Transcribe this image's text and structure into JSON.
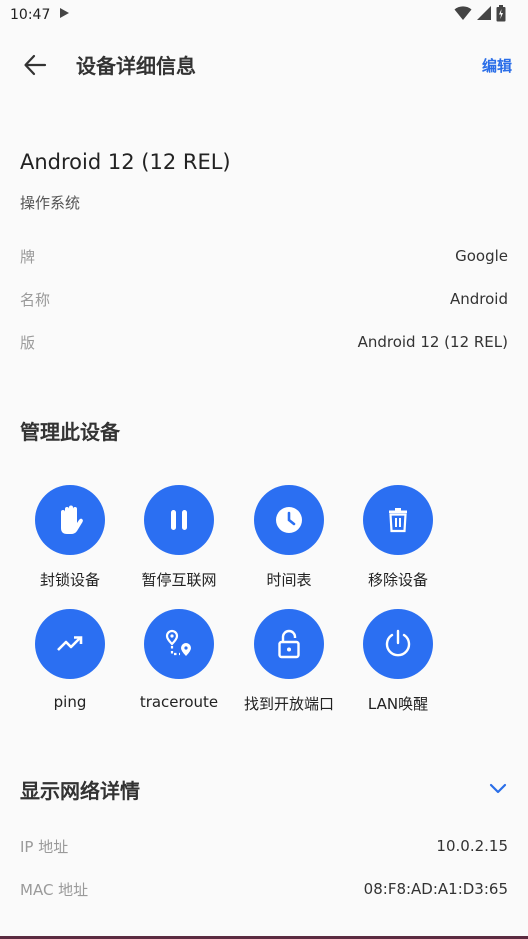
{
  "status_bar": {
    "time": "10:47"
  },
  "app_bar": {
    "title": "设备详细信息",
    "edit_label": "编辑"
  },
  "device": {
    "os_title": "Android 12 (12 REL)",
    "os_subtitle": "操作系统",
    "details": [
      {
        "key": "牌",
        "value": "Google"
      },
      {
        "key": "名称",
        "value": "Android"
      },
      {
        "key": "版",
        "value": "Android 12 (12 REL)"
      }
    ]
  },
  "manage": {
    "title": "管理此设备",
    "actions": [
      {
        "label": "封锁设备",
        "icon": "hand-stop-icon"
      },
      {
        "label": "暂停互联网",
        "icon": "pause-icon"
      },
      {
        "label": "时间表",
        "icon": "clock-icon"
      },
      {
        "label": "移除设备",
        "icon": "trash-icon"
      },
      {
        "label": "ping",
        "icon": "trending-up-icon"
      },
      {
        "label": "traceroute",
        "icon": "route-icon"
      },
      {
        "label": "找到开放端口",
        "icon": "open-lock-icon"
      },
      {
        "label": "LAN唤醒",
        "icon": "power-icon"
      }
    ]
  },
  "network": {
    "title": "显示网络详情",
    "rows": [
      {
        "key": "IP 地址",
        "value": "10.0.2.15"
      },
      {
        "key": "MAC 地址",
        "value": "08:F8:AD:A1:D3:65"
      }
    ]
  },
  "colors": {
    "accent": "#2b6ff2",
    "link": "#2a6ee8",
    "background": "#fafafa"
  }
}
